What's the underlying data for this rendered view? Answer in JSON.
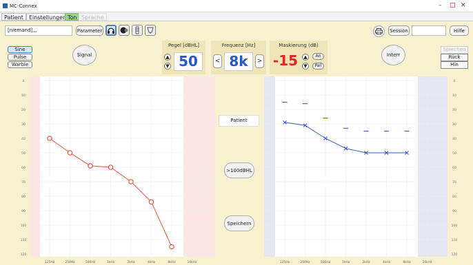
{
  "window": {
    "title": "MC-Connex",
    "controls": [
      "–",
      "□",
      "✕"
    ]
  },
  "menu": {
    "tabs": [
      {
        "label": "Patient",
        "state": "normal"
      },
      {
        "label": "Einstellungen",
        "state": "normal"
      },
      {
        "label": "Ton",
        "state": "active"
      },
      {
        "label": "Sprache",
        "state": "disabled"
      }
    ]
  },
  "toolbar": {
    "patient_field": "[niemand],,,",
    "parameter_label": "Parameter",
    "session_label": "Session",
    "help_label": "Hilfe",
    "transducer_icons": [
      "headphones-icon",
      "bone-conductor-icon",
      "insert-earphone-icon",
      "free-field-icon"
    ],
    "print_icon": "printer-icon"
  },
  "signal": {
    "options": [
      "Sine",
      "Pulse",
      "Warble"
    ],
    "selected": "Sine",
    "signal_button": "Signal"
  },
  "level": {
    "header": "Pegel [dBHL]",
    "value": "50"
  },
  "frequency": {
    "header": "Frequenz [Hz]",
    "value": "8k",
    "prev": "<",
    "next": ">"
  },
  "masking": {
    "header": "Maskierung (dB)",
    "value": "-15",
    "on_label": "An",
    "rel_label": "Rel"
  },
  "interrupt_label": "Interr",
  "speech_nav": {
    "sprechen": "Sprechen",
    "back": "Rück",
    "forward": "Hin"
  },
  "center": {
    "patient_label": "Patient",
    "over100_label": ">100dBHL",
    "save_label": "Speichern"
  },
  "accent": {
    "right": "#e8533a",
    "left": "#3a56c8",
    "value_blue": "#2a57c6",
    "value_red": "#e52320"
  },
  "chart_data": [
    {
      "type": "line",
      "title": "",
      "ear": "right",
      "x": [
        "125Hz",
        "250Hz",
        "500Hz",
        "1kHz",
        "2kHz",
        "4kHz",
        "8kHz",
        "16kHz"
      ],
      "y_ticks": [
        0,
        10,
        20,
        30,
        40,
        50,
        60,
        70,
        80,
        90,
        100,
        110,
        120
      ],
      "ylim": [
        0,
        120
      ],
      "y_inverted": true,
      "series": [
        {
          "marker": "circle",
          "color": "#e8533a",
          "points": [
            [
              "125Hz",
              40
            ],
            [
              "250Hz",
              50
            ],
            [
              "500Hz",
              59
            ],
            [
              "1kHz",
              60
            ],
            [
              "2kHz",
              70
            ],
            [
              "4kHz",
              84
            ],
            [
              "8kHz",
              115
            ]
          ]
        }
      ]
    },
    {
      "type": "line",
      "title": "",
      "ear": "left",
      "x": [
        "125Hz",
        "250Hz",
        "500Hz",
        "1kHz",
        "2kHz",
        "4kHz",
        "8kHz",
        "16kHz"
      ],
      "y_ticks": [
        0,
        10,
        20,
        30,
        40,
        50,
        60,
        70,
        80,
        90,
        100,
        110,
        120
      ],
      "ylim": [
        0,
        120
      ],
      "y_inverted": true,
      "series": [
        {
          "marker": "cross",
          "color": "#3a56c8",
          "points": [
            [
              "125Hz",
              29
            ],
            [
              "250Hz",
              31
            ],
            [
              "500Hz",
              40
            ],
            [
              "1kHz",
              47
            ],
            [
              "2kHz",
              50
            ],
            [
              "4kHz",
              50
            ],
            [
              "8kHz",
              50
            ]
          ]
        },
        {
          "marker": "dash",
          "color": "#3a56c8",
          "connected": false,
          "points": [
            [
              "125Hz",
              15
            ],
            [
              "250Hz",
              16
            ],
            [
              "500Hz",
              26
            ],
            [
              "1kHz",
              33
            ],
            [
              "2kHz",
              35
            ],
            [
              "4kHz",
              35
            ],
            [
              "8kHz",
              35
            ]
          ]
        }
      ]
    }
  ]
}
